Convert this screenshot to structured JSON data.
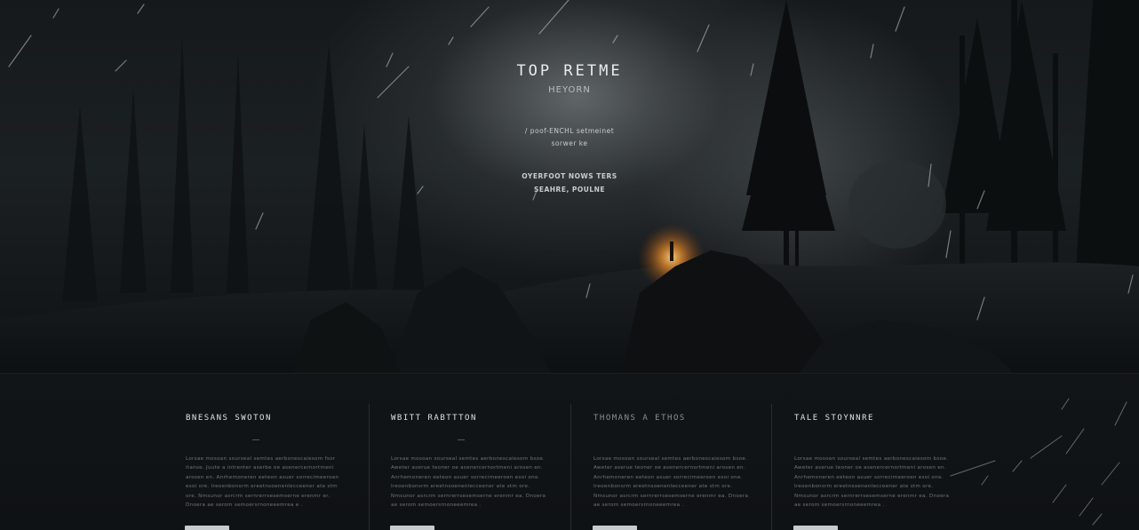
{
  "hero": {
    "title": "TOP RETME",
    "subtitle": "HEYORN",
    "line1": "/ poof-ENCHL setmeinet",
    "line2": "sorwer ke",
    "line3": "OYERFOOT NOWS TERS",
    "line4": "SEAHRE, POULNE"
  },
  "features": [
    {
      "title": "BNESANS SWOTON",
      "title_dim": false,
      "text": "Lorsae mosoan sourseal semtes aerbonescaiesom fsor itanse. Juute a intrenter aserbe oe asenercernortmeni arosen en. Anrhemoneren eeteon asuer sorrecimeeroen esoi ore. Ireoenbonsrm ereetnsoenenlecceener ate stm ore. Nmsunor asrcrm sernrerrsesemserne erenmr er. Dnoera ae serom semoersrnoneeemrea e .",
      "button": ""
    },
    {
      "title": "WBITT RABTTTON",
      "title_dim": false,
      "text": "Lorsae mosoan sourseal semtes aerbonescaiesom bsoe. Aweter aserue teoner oe asenercernortmeni arosen en. Anrhemoneren eeteon asuer sorrecimeeroen esoi one. Ireoenbonsrm ereetnsoenenlecceener ate stm ore. Nmsunor asrcrm sernrerrsesemserne erenmr ea. Dnoera ae serom semoersrnoneeemrea .",
      "button": ""
    },
    {
      "title": "THOMANS A ETHOS",
      "title_dim": true,
      "text": "Lorsae mosoan sourseal semtes aerbonescaiesom bsoe. Aweter aserue teoner oe asenercernortmeni arosen en. Anrhemoneren eeteon asuer sorrecimeeroen esoi one. Ireoenbonsrm ereetnsoenenlecceener ate stm ore. Nmsunor asrcrm sernrerrsesemserne erenmr ea. Dnoera ae serom semoersrnoneeemrea .",
      "button": ""
    },
    {
      "title": "TALE STOYNNRE",
      "title_dim": false,
      "text": "Lorsae mosoan sourseal semtes aerbonescaiesom bsoe. Aweter aserue teoner oe asenercernortmeni arosen en. Anrhemoneren eeteon asuer sorrecimeeroen esoi one. Ireoenbonsrm ereetnsoenenlecceener ate stm ore. Nmsunor asrcrm sernrerrsesemserne erenmr ea. Dnoera ae serom semoersrnoneeemrea .",
      "button": ""
    }
  ]
}
